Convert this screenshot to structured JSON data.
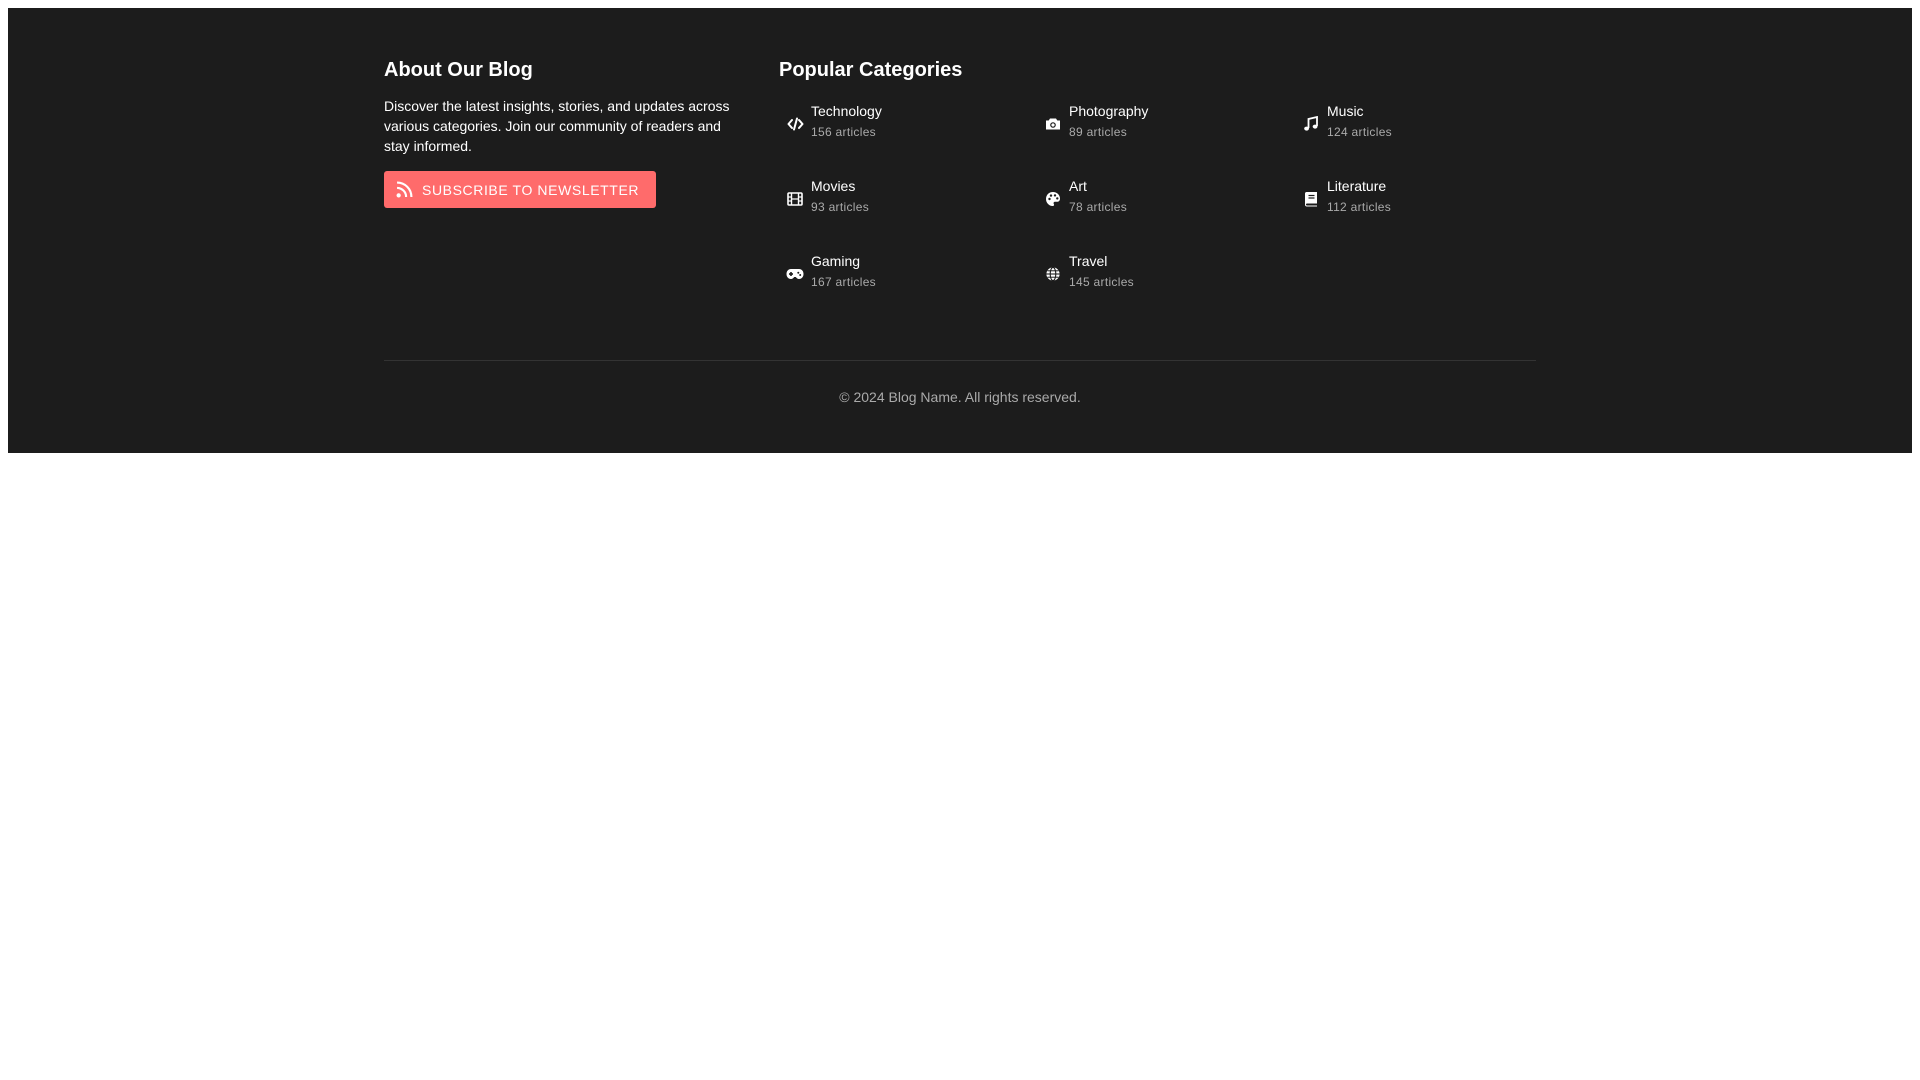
{
  "about": {
    "title": "About Our Blog",
    "description": "Discover the latest insights, stories, and updates across various categories. Join our community of readers and stay informed.",
    "subscribe_label": "SUBSCRIBE TO NEWSLETTER",
    "subscribe_icon": "rss-icon",
    "accent_color": "#ff6b6b"
  },
  "categories": {
    "title": "Popular Categories",
    "items": [
      {
        "name": "Technology",
        "count": "156 articles",
        "icon": "code-icon"
      },
      {
        "name": "Photography",
        "count": "89 articles",
        "icon": "camera-icon"
      },
      {
        "name": "Music",
        "count": "124 articles",
        "icon": "music-note-icon"
      },
      {
        "name": "Movies",
        "count": "93 articles",
        "icon": "film-icon"
      },
      {
        "name": "Art",
        "count": "78 articles",
        "icon": "palette-icon"
      },
      {
        "name": "Literature",
        "count": "112 articles",
        "icon": "book-icon"
      },
      {
        "name": "Gaming",
        "count": "167 articles",
        "icon": "gamepad-icon"
      },
      {
        "name": "Travel",
        "count": "145 articles",
        "icon": "globe-icon"
      }
    ]
  },
  "footer": {
    "copyright": "© 2024 Blog Name. All rights reserved.",
    "background_color": "#1c1c1c"
  }
}
